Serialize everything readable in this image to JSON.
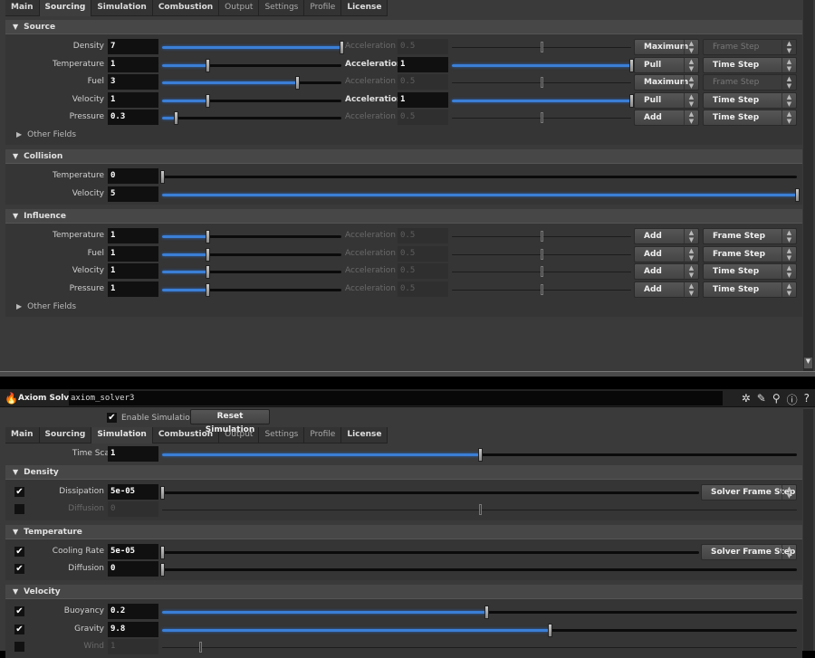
{
  "tabs": [
    "Main",
    "Sourcing",
    "Simulation",
    "Combustion",
    "Output",
    "Settings",
    "Profile",
    "License"
  ],
  "tabs_bold": [
    true,
    true,
    true,
    true,
    false,
    false,
    false,
    true
  ],
  "top": {
    "active_tab": 1,
    "other_fields": "Other Fields",
    "sections": [
      {
        "title": "Source",
        "other": true,
        "rows": [
          {
            "label": "Density",
            "value": "7",
            "fill": 1.0,
            "accel": {
              "label": "Acceleration",
              "value": "0.5",
              "fill": 0.5,
              "enabled": false
            },
            "menus": [
              {
                "label": "Maximum",
                "enabled": true
              },
              {
                "label": "Frame Step",
                "enabled": false
              }
            ]
          },
          {
            "label": "Temperature",
            "value": "1",
            "fill": 0.25,
            "accel": {
              "label": "Acceleration",
              "value": "1",
              "fill": 1.0,
              "enabled": true
            },
            "menus": [
              {
                "label": "Pull",
                "enabled": true
              },
              {
                "label": "Time Step",
                "enabled": true
              }
            ]
          },
          {
            "label": "Fuel",
            "value": "3",
            "fill": 0.75,
            "accel": {
              "label": "Acceleration",
              "value": "0.5",
              "fill": 0.5,
              "enabled": false
            },
            "menus": [
              {
                "label": "Maximum",
                "enabled": true
              },
              {
                "label": "Frame Step",
                "enabled": false
              }
            ]
          },
          {
            "label": "Velocity",
            "value": "1",
            "fill": 0.25,
            "accel": {
              "label": "Acceleration",
              "value": "1",
              "fill": 1.0,
              "enabled": true
            },
            "menus": [
              {
                "label": "Pull",
                "enabled": true
              },
              {
                "label": "Time Step",
                "enabled": true
              }
            ]
          },
          {
            "label": "Pressure",
            "value": "0.3",
            "fill": 0.075,
            "accel": {
              "label": "Acceleration",
              "value": "0.5",
              "fill": 0.5,
              "enabled": false
            },
            "menus": [
              {
                "label": "Add",
                "enabled": true
              },
              {
                "label": "Time Step",
                "enabled": true
              }
            ]
          }
        ]
      },
      {
        "title": "Collision",
        "other": false,
        "rows": [
          {
            "label": "Temperature",
            "value": "0",
            "fill": 0
          },
          {
            "label": "Velocity",
            "value": "5",
            "fill": 1.0
          }
        ]
      },
      {
        "title": "Influence",
        "other": true,
        "rows": [
          {
            "label": "Temperature",
            "value": "1",
            "fill": 0.25,
            "accel": {
              "label": "Acceleration",
              "value": "0.5",
              "fill": 0.5,
              "enabled": false
            },
            "menus": [
              {
                "label": "Add",
                "enabled": true
              },
              {
                "label": "Frame Step",
                "enabled": true
              }
            ]
          },
          {
            "label": "Fuel",
            "value": "1",
            "fill": 0.25,
            "accel": {
              "label": "Acceleration",
              "value": "0.5",
              "fill": 0.5,
              "enabled": false
            },
            "menus": [
              {
                "label": "Add",
                "enabled": true
              },
              {
                "label": "Frame Step",
                "enabled": true
              }
            ]
          },
          {
            "label": "Velocity",
            "value": "1",
            "fill": 0.25,
            "accel": {
              "label": "Acceleration",
              "value": "0.5",
              "fill": 0.5,
              "enabled": false
            },
            "menus": [
              {
                "label": "Add",
                "enabled": true
              },
              {
                "label": "Time Step",
                "enabled": true
              }
            ]
          },
          {
            "label": "Pressure",
            "value": "1",
            "fill": 0.25,
            "accel": {
              "label": "Acceleration",
              "value": "0.5",
              "fill": 0.5,
              "enabled": false
            },
            "menus": [
              {
                "label": "Add",
                "enabled": true
              },
              {
                "label": "Time Step",
                "enabled": true
              }
            ]
          }
        ]
      }
    ]
  },
  "bottom": {
    "node_type": "Axiom Solver",
    "node_name": "axiom_solver3",
    "enable_label": "Enable Simulation",
    "enable_checked": true,
    "reset_label": "Reset Simulation",
    "active_tab": 2,
    "time_scale": {
      "label": "Time Scale",
      "value": "1",
      "fill": 0.5
    },
    "sections": [
      {
        "title": "Density",
        "rows": [
          {
            "check": true,
            "label": "Dissipation",
            "value": "5e-05",
            "fill": 0,
            "menu": "Solver Frame Step"
          },
          {
            "check": false,
            "label": "Diffusion",
            "value": "0",
            "fill": 0.5,
            "disabled": true
          }
        ]
      },
      {
        "title": "Temperature",
        "rows": [
          {
            "check": true,
            "label": "Cooling Rate",
            "value": "5e-05",
            "fill": 0,
            "menu": "Solver Frame Step"
          },
          {
            "check": true,
            "label": "Diffusion",
            "value": "0",
            "fill": 0
          }
        ]
      },
      {
        "title": "Velocity",
        "rows": [
          {
            "check": true,
            "label": "Buoyancy",
            "value": "0.2",
            "fill": 0.51
          },
          {
            "check": true,
            "label": "Gravity",
            "value": "9.8",
            "fill": 0.61
          },
          {
            "check": false,
            "label": "Wind",
            "value": "1",
            "fill": 0.06,
            "disabled": true
          }
        ]
      }
    ]
  }
}
